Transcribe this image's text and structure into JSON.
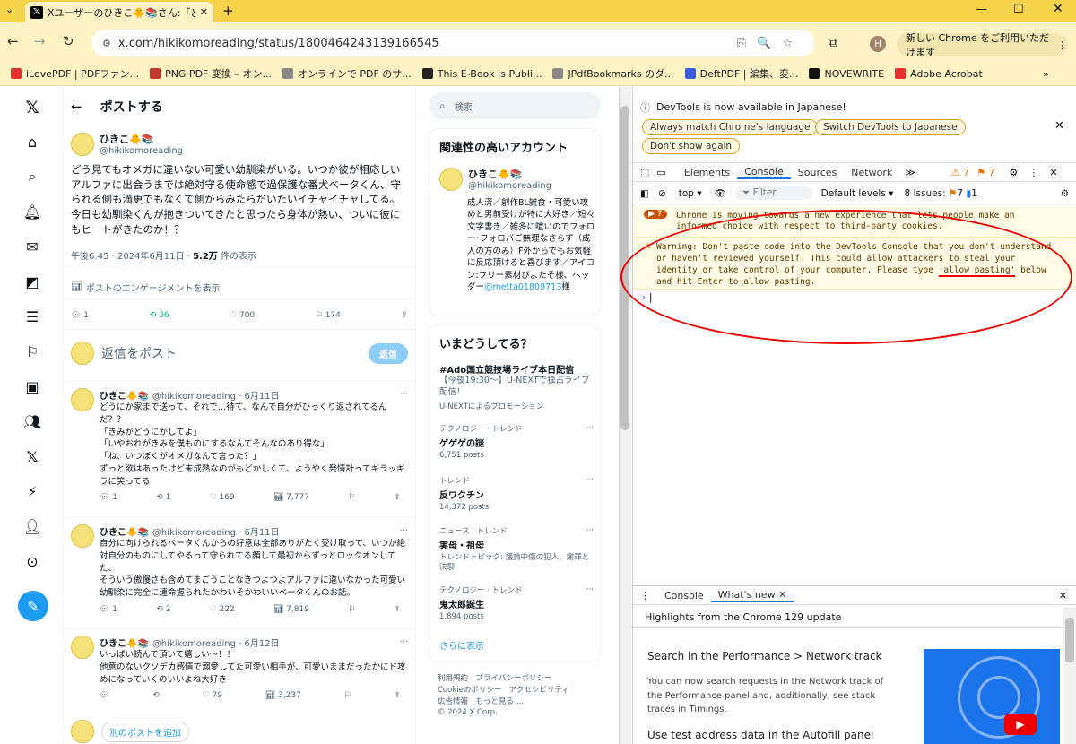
{
  "browser": {
    "tab_title": "Xユーザーのひきこ🐥📚さん:「どう見",
    "url": "x.com/hikikomoreading/status/1800464243139166545",
    "update_label": "新しい Chrome をご利用いただけます",
    "profile_initial": "H",
    "bookmarks": [
      "iLovePDF | PDFファン...",
      "PNG PDF 変換 – オン...",
      "オンラインで PDF のサ...",
      "This E-Book is Publi...",
      "JPdfBookmarks のダ...",
      "DeftPDF | 編集、変...",
      "NOVEWRITE",
      "Adobe Acrobat"
    ],
    "bookmark_colors": [
      "#e5322d",
      "#c0392b",
      "#888888",
      "#222222",
      "#888888",
      "#3b5bdb",
      "#111111",
      "#e5322d"
    ]
  },
  "x": {
    "header_title": "ポストする",
    "author_name": "ひきこ🐥📚",
    "author_handle": "@hikikomoreading",
    "post_text_1": "どう見てもオメガに違いない可愛い幼馴染がいる。いつか彼が相応しいアルファに出会うまでは絶対守る使命感で過保護な番犬ベータくん、守られる側も満更でもなくて側からみたらだいたいイチャイチャしてる。",
    "post_text_2": "今日も幼馴染くんが抱きついてきたと思ったら身体が熱い、ついに彼にもヒートがきたのか！？",
    "post_time": "午後6:45 · 2024年6月11日 · ",
    "views": "5.2万",
    "views_label": " 件の表示",
    "engagement": "ポストのエンゲージメントを表示",
    "stats": {
      "replies": "1",
      "reposts": "36",
      "likes": "700",
      "bookmarks": "174"
    },
    "reply_placeholder": "返信をポスト",
    "reply_button": "返信",
    "replies": [
      {
        "name": "ひきこ🐥📚",
        "handle": "@hikikomoreading · 6月11日",
        "text": "どうにか家まで送って、それで…待て、なんで自分がひっくり返されてるんだ？？\n「きみがどうにかしてよ」\n「いやおれがきみを僕ものにするなんてそんなのあり得な」\n「ね、いつぼくがオメガなんて言った？」\nずっと欲はあったけど未成熟なのがもどかしくて、ようやく発情計ってギラッギラに笑ってる",
        "reply": "1",
        "repost": "1",
        "like": "169",
        "view": "7,777"
      },
      {
        "name": "ひきこ🐥📚",
        "handle": "@hikikomoreading · 6月11日",
        "text": "自分に向けられるベータくんからの好意は全部ありがたく受け取って、いつか絶対自分のものにしてやるって守られてる顔して最初からずっとロックオンしてた、\nそういう傲慢さも含めてまごうことなきつよつよアルファに違いなかった可愛い幼馴染に完全に連命握られたかわいそかわいいベータくんのお話。",
        "reply": "1",
        "repost": "2",
        "like": "222",
        "view": "7,819"
      },
      {
        "name": "ひきこ🐥📚",
        "handle": "@hikikomoreading · 6月12日",
        "text": "いっぱい読んで頂いて嬉しい〜！！\n他意のないクソデカ感情で溺愛してた可愛い相手が、可愛いままだったかにド攻めになっていくのいいよね大好き",
        "reply": "",
        "repost": "",
        "like": "79",
        "view": "3,237"
      }
    ],
    "add_post": "別のポストを追加",
    "search_placeholder": "検索",
    "related_title": "関連性の高いアカウント",
    "related_name": "ひきこ🐥📚",
    "related_handle": "@hikikomoreading",
    "related_bio": "成人済／創作BL雑食・可愛い攻めと男前受けが特に大好き／短々文字書き／雑多に喧いのでフォロー･フォロバご無理なさらず（成人の方のみ）F外からでもお気軽に反応頂けると喜びます／アイコン:フリー素材びよたそ様、ヘッダー",
    "related_link": "@metta01809713",
    "related_suffix": "様",
    "trends_title": "いまどうしてる？",
    "promo_tag": "#Ado国立競技場ライブ本日配信",
    "promo_text": "【今夜19:30〜】U-NEXTで独占ライブ配信！",
    "promo_by": "U-NEXTによるプロモーション",
    "trends": [
      {
        "cat": "テクノロジー · トレンド",
        "name": "ゲゲゲの謎",
        "count": "6,751 posts"
      },
      {
        "cat": "トレンド",
        "name": "反ワクチン",
        "count": "14,372 posts"
      },
      {
        "cat": "ニュース · トレンド",
        "name": "実母・祖母",
        "count": "トレンドトピック: 議論中傷の犯人、謝罪と決裂"
      },
      {
        "cat": "テクノロジー · トレンド",
        "name": "鬼太郎誕生",
        "count": "1,894 posts"
      }
    ],
    "show_more": "さらに表示",
    "footer_1": "利用規約　プライバシーポリシー",
    "footer_2": "Cookieのポリシー　アクセシビリティ",
    "footer_3": "広告情報　もっと見る …",
    "footer_4": "© 2024 X Corp."
  },
  "devtools": {
    "notice": "DevTools is now available in Japanese!",
    "btn_match": "Always match Chrome's language",
    "btn_switch": "Switch DevTools to Japanese",
    "btn_dont": "Don't show again",
    "tabs": [
      "Elements",
      "Console",
      "Sources",
      "Network"
    ],
    "warn_count": "7",
    "issue_count": "7",
    "context": "top",
    "filter": "Filter",
    "levels": "Default levels",
    "issues": "8 Issues:",
    "issues_warn": "7",
    "issues_info": "1",
    "msg1_badge": "7",
    "msg1": "Chrome is moving towards a new experience that lets people make an informed choice with respect to third-party cookies.",
    "warning": "Warning: Don't paste code into the DevTools Console that you don't understand or haven't reviewed yourself. This could allow attackers to steal your identity or take control of your computer. Please type",
    "allow": "'allow pasting'",
    "warning_end": "below and hit Enter to allow pasting.",
    "drawer_tabs": [
      "Console",
      "What's new"
    ],
    "highlights": "Highlights from the Chrome 129 update",
    "wn_title1": "Search in the Performance > Network track",
    "wn_text1": "You can now search requests in the Network track of the Performance panel and, additionally, see stack traces in Timings.",
    "wn_title2": "Use test address data in the Autofill panel"
  }
}
